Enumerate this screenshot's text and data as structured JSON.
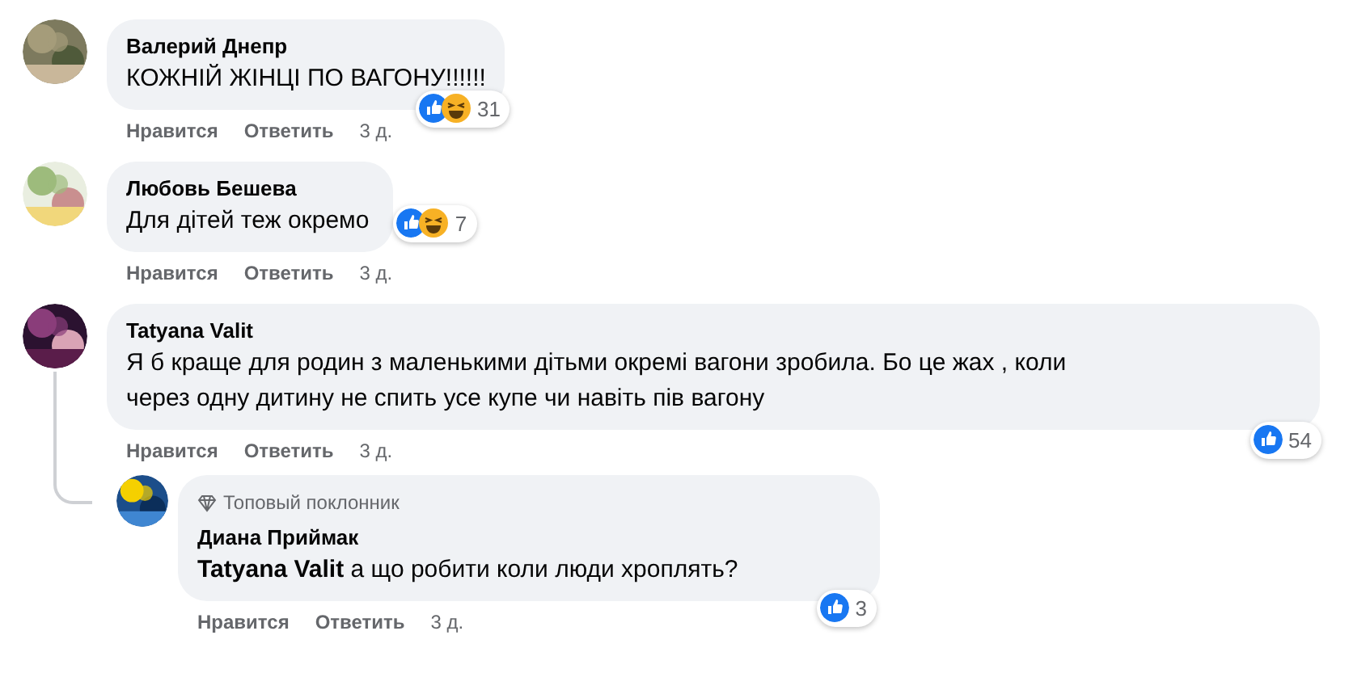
{
  "comments": [
    {
      "author": "Валерий Днепр",
      "text": "КОЖНІЙ ЖІНЦІ ПО ВАГОНУ!!!!!!",
      "reactions": [
        {
          "kind": "like"
        },
        {
          "kind": "haha"
        }
      ],
      "reaction_count": "31",
      "actions": [
        "Нравится",
        "Ответить"
      ],
      "time": "3 д."
    },
    {
      "author": "Любовь Бешева",
      "text": "Для дітей теж окремо",
      "reactions": [
        {
          "kind": "like"
        },
        {
          "kind": "haha"
        }
      ],
      "reaction_count": "7",
      "actions": [
        "Нравится",
        "Ответить"
      ],
      "time": "3 д."
    },
    {
      "author": "Tatyana Valit",
      "text": "Я б краще для родин з маленькими дітьми окремі вагони зробила. Бо це жах , коли через одну дитину не спить усе купе чи навіть пів вагону",
      "reactions": [
        {
          "kind": "like"
        }
      ],
      "reaction_count": "54",
      "actions": [
        "Нравится",
        "Ответить"
      ],
      "time": "3 д.",
      "replies": [
        {
          "badge": "Топовый поклонник",
          "author": "Диана Приймак",
          "text": "**Tatyana Valit** а що робити коли люди хроплять?",
          "reactions": [
            {
              "kind": "like"
            }
          ],
          "reaction_count": "3",
          "actions": [
            "Нравится",
            "Ответить"
          ],
          "time": "3 д."
        }
      ]
    }
  ]
}
